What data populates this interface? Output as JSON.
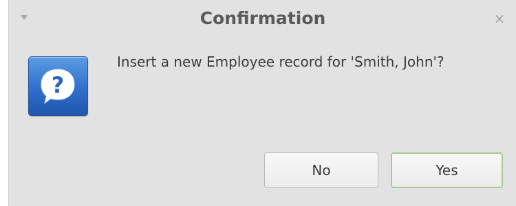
{
  "window": {
    "title": "Confirmation",
    "close_glyph": "×",
    "menu_icon": "window-menu-arrow-icon",
    "close_icon": "close-icon"
  },
  "dialog": {
    "icon": "question-icon",
    "icon_glyph": "?",
    "message": "Insert a new Employee record for 'Smith, John'?"
  },
  "buttons": {
    "no_label": "No",
    "yes_label": "Yes",
    "default": "yes"
  },
  "colors": {
    "dialog_bg": "#e2e2e2",
    "icon_blue": "#2f6fcd",
    "default_button_border": "#a6c98e",
    "title_text": "#5a5a5a"
  }
}
